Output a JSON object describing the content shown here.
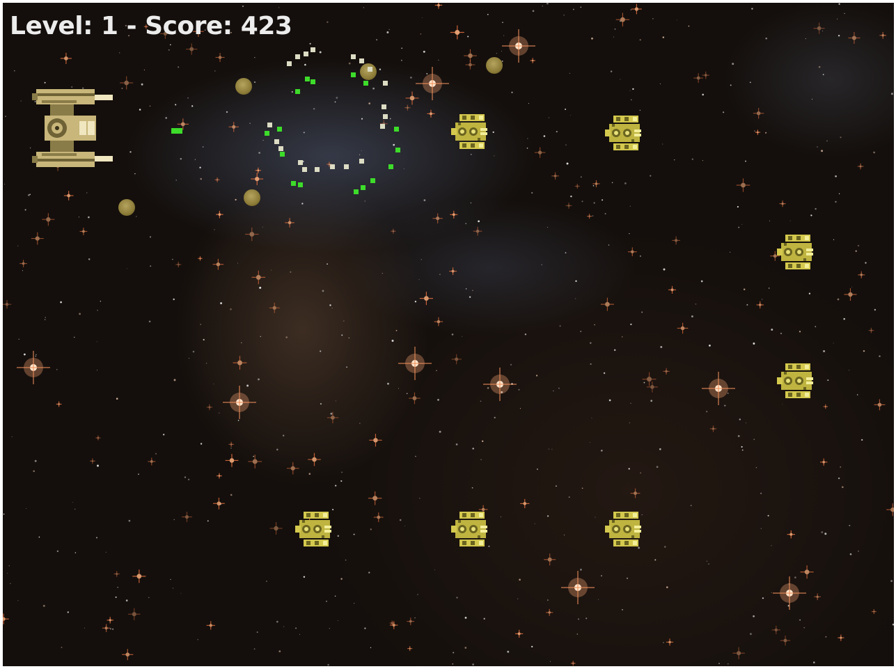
{
  "hud": {
    "level_label": "Level:",
    "level": "1",
    "separator": "-",
    "score_label": "Score:",
    "score": "423"
  },
  "colors": {
    "hud_text": "#ececec",
    "ship_body": "#c8b67a",
    "ship_dark": "#6e6236",
    "ship_light": "#f0e6c0",
    "enemy_body": "#d4c94e",
    "enemy_dark": "#6a6420",
    "orb": "#8c7c38",
    "laser": "#3ddc2a",
    "debris": "#dcdcc4"
  },
  "sprites": {
    "player": "player-ship-icon",
    "enemy": "enemy-ship-icon",
    "orb": "enemy-orb-projectile",
    "laser": "player-laser-bolt",
    "debris": "explosion-debris"
  }
}
